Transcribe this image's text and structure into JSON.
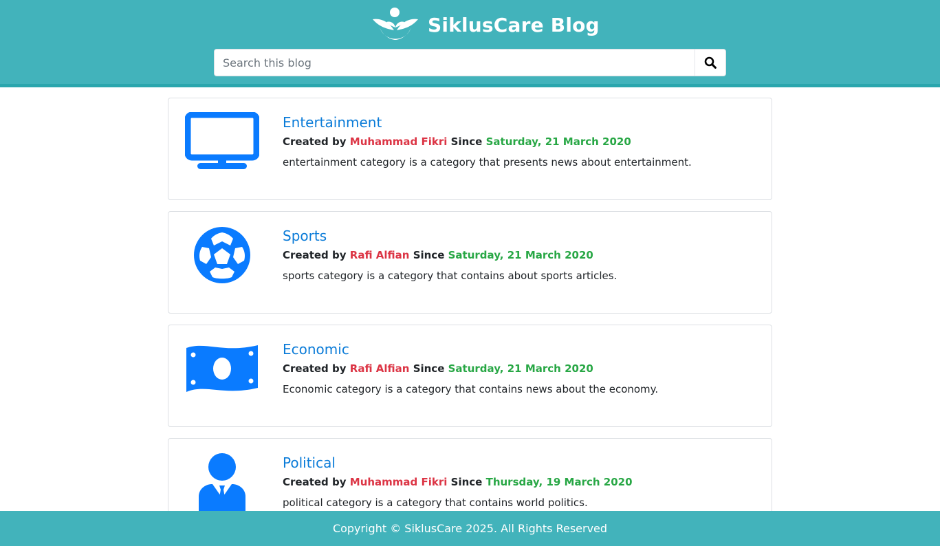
{
  "header": {
    "brand_name": "SiklusCare Blog",
    "logo_icon": "sikluscare-logo-icon",
    "search": {
      "placeholder": "Search this blog",
      "value": "",
      "button_icon": "search-icon"
    }
  },
  "categories": [
    {
      "title": "Entertainment",
      "icon": "tv-icon",
      "created_by_label": "Created by",
      "author": "Muhammad Fikri",
      "since_label": "Since",
      "date": "Saturday, 21 March 2020",
      "description": "entertainment category is a category that presents news about entertainment."
    },
    {
      "title": "Sports",
      "icon": "soccer-ball-icon",
      "created_by_label": "Created by",
      "author": "Rafi Alfian",
      "since_label": "Since",
      "date": "Saturday, 21 March 2020",
      "description": "sports category is a category that contains about sports articles."
    },
    {
      "title": "Economic",
      "icon": "money-bill-icon",
      "created_by_label": "Created by",
      "author": "Rafi Alfian",
      "since_label": "Since",
      "date": "Saturday, 21 March 2020",
      "description": "Economic category is a category that contains news about the economy."
    },
    {
      "title": "Political",
      "icon": "user-tie-icon",
      "created_by_label": "Created by",
      "author": "Muhammad Fikri",
      "since_label": "Since",
      "date": "Thursday, 19 March 2020",
      "description": "political category is a category that contains world politics."
    }
  ],
  "footer": {
    "copyright": "Copyright © SiklusCare 2025. All Rights Reserved"
  },
  "colors": {
    "header_bg": "#42b3bb",
    "link": "#0a7bd8",
    "author": "#dc3545",
    "date": "#28a745",
    "icon": "#0a7bff"
  }
}
